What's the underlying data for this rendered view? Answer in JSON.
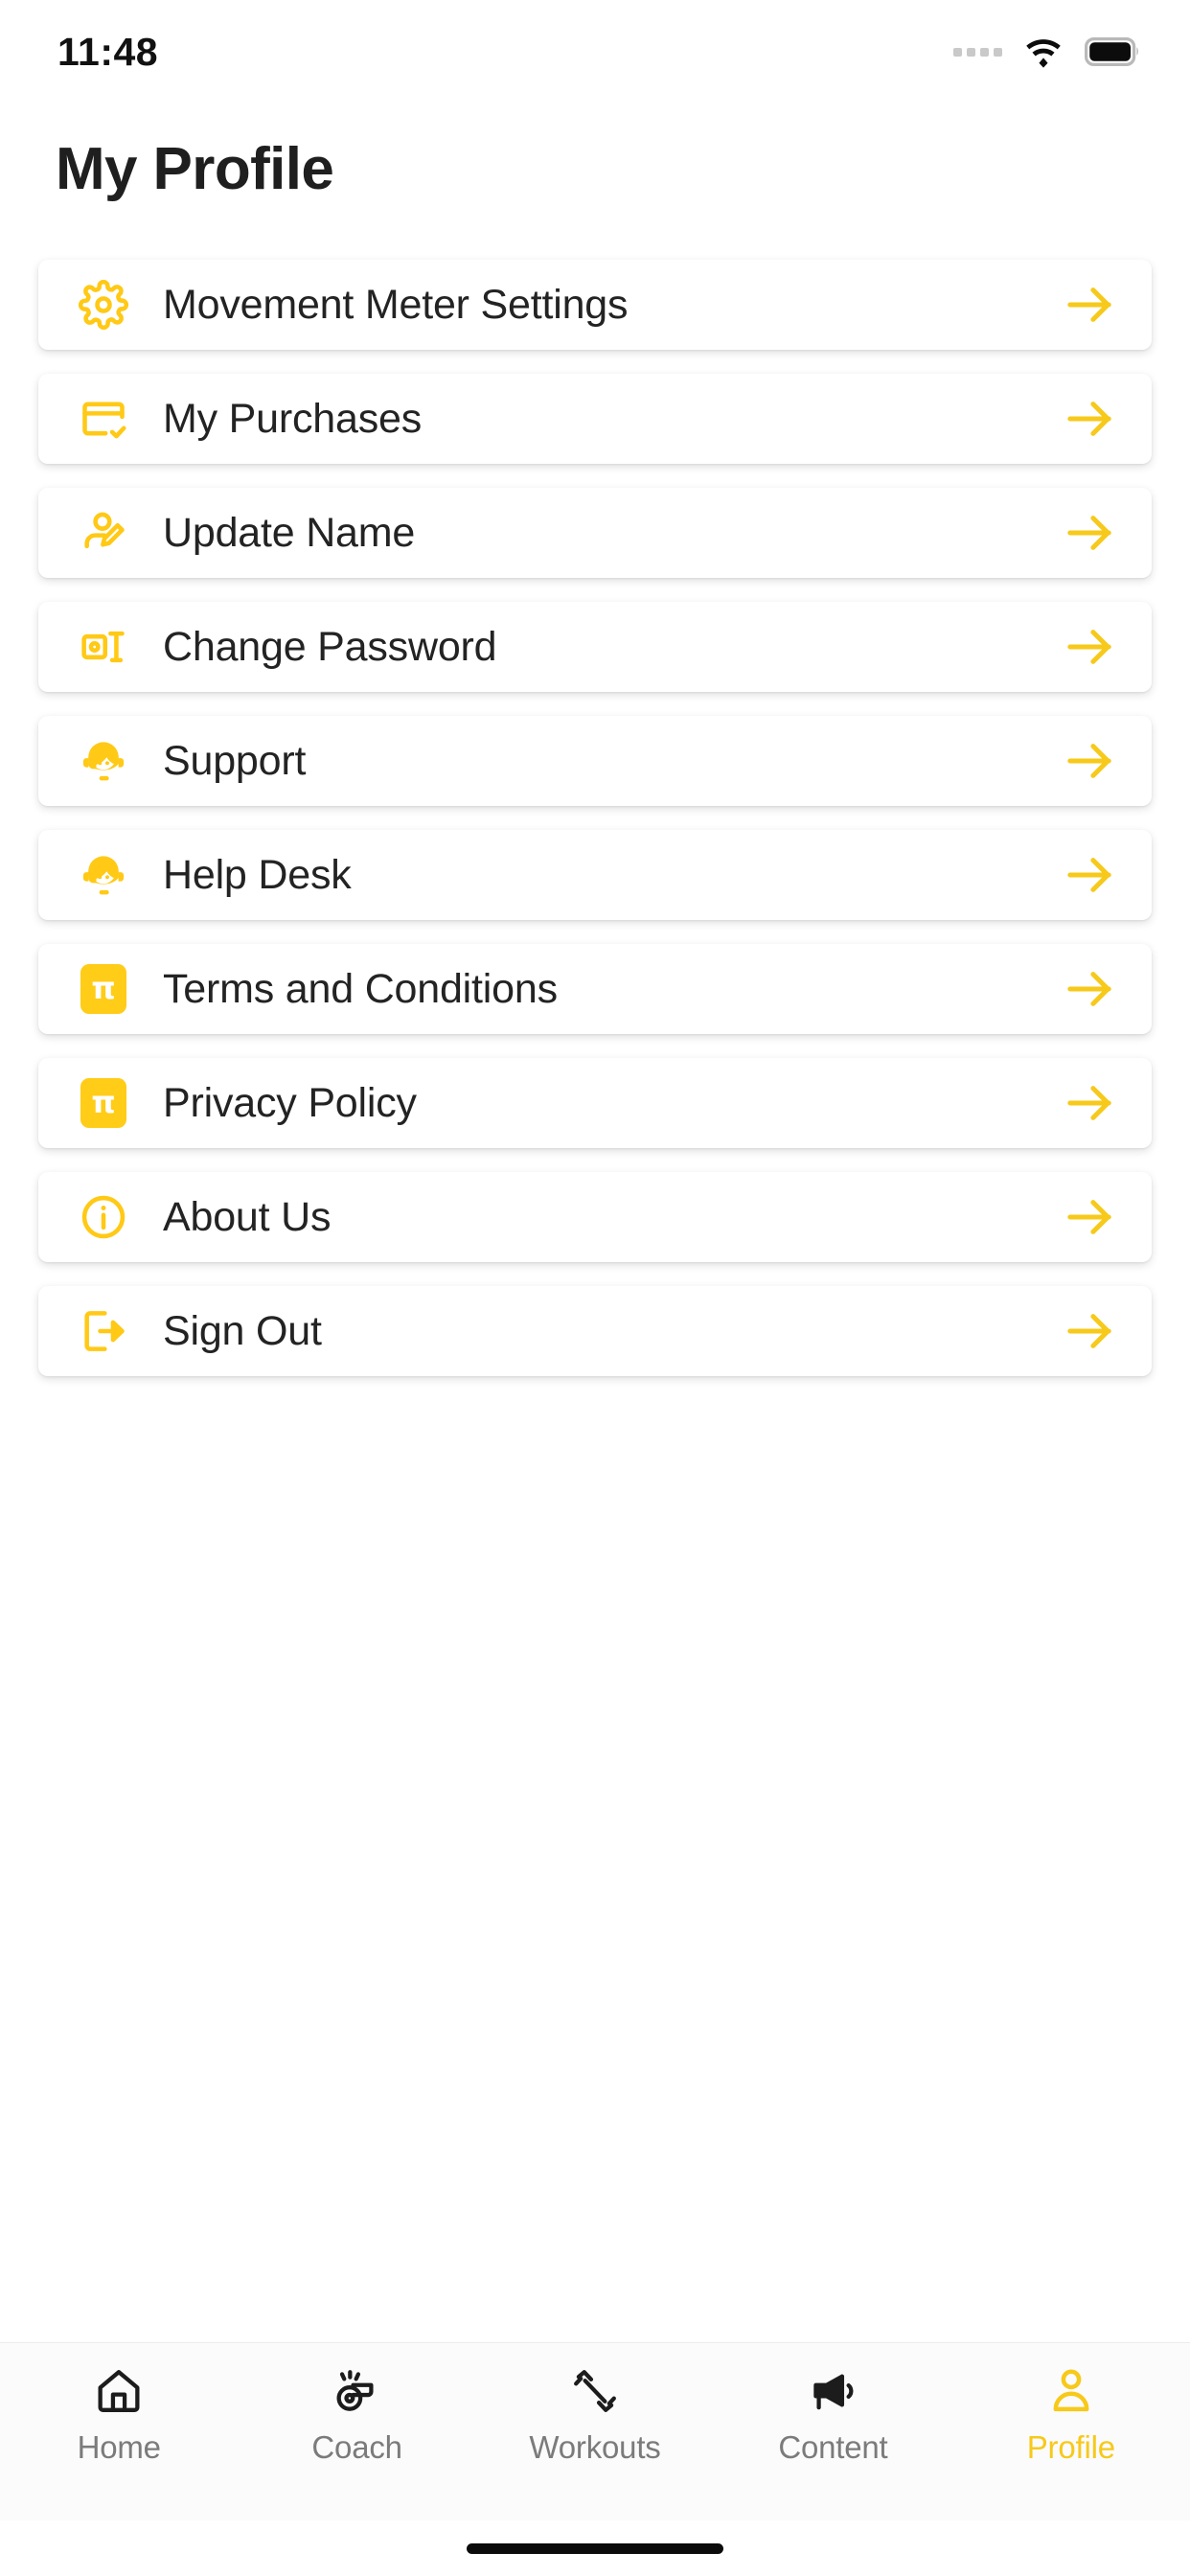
{
  "status_bar": {
    "time": "11:48",
    "signal_icon": "signal-dots-icon",
    "wifi_icon": "wifi-icon",
    "battery_icon": "battery-full-icon"
  },
  "header": {
    "title": "My Profile"
  },
  "colors": {
    "accent": "#FFCC18",
    "accent_arrow": "#F7C91A",
    "text": "#232323",
    "title": "#1F1F1F",
    "nav_inactive": "#7B7B7B",
    "card_bg": "#FFFFFF",
    "page_bg": "#FFFFFF",
    "nav_bg": "#FBFBFB"
  },
  "menu": {
    "items": [
      {
        "label": "Movement Meter Settings",
        "icon": "gear-icon",
        "arrow": "arrow-right-icon"
      },
      {
        "label": "My Purchases",
        "icon": "card-check-icon",
        "arrow": "arrow-right-icon"
      },
      {
        "label": "Update Name",
        "icon": "user-edit-icon",
        "arrow": "arrow-right-icon"
      },
      {
        "label": "Change Password",
        "icon": "password-key-icon",
        "arrow": "arrow-right-icon"
      },
      {
        "label": "Support",
        "icon": "support-agent-icon",
        "arrow": "arrow-right-icon"
      },
      {
        "label": "Help Desk",
        "icon": "support-agent-icon",
        "arrow": "arrow-right-icon"
      },
      {
        "label": "Terms and Conditions",
        "icon": "pi-badge-icon",
        "icon_glyph": "π",
        "arrow": "arrow-right-icon"
      },
      {
        "label": "Privacy Policy",
        "icon": "pi-badge-icon",
        "icon_glyph": "π",
        "arrow": "arrow-right-icon"
      },
      {
        "label": "About Us",
        "icon": "info-circle-icon",
        "arrow": "arrow-right-icon"
      },
      {
        "label": "Sign Out",
        "icon": "sign-out-icon",
        "arrow": "arrow-right-icon"
      }
    ]
  },
  "bottom_nav": {
    "items": [
      {
        "label": "Home",
        "icon": "house-icon",
        "active": false
      },
      {
        "label": "Coach",
        "icon": "whistle-icon",
        "active": false
      },
      {
        "label": "Workouts",
        "icon": "dumbbell-icon",
        "active": false
      },
      {
        "label": "Content",
        "icon": "megaphone-icon",
        "active": false
      },
      {
        "label": "Profile",
        "icon": "person-icon",
        "active": true
      }
    ]
  }
}
